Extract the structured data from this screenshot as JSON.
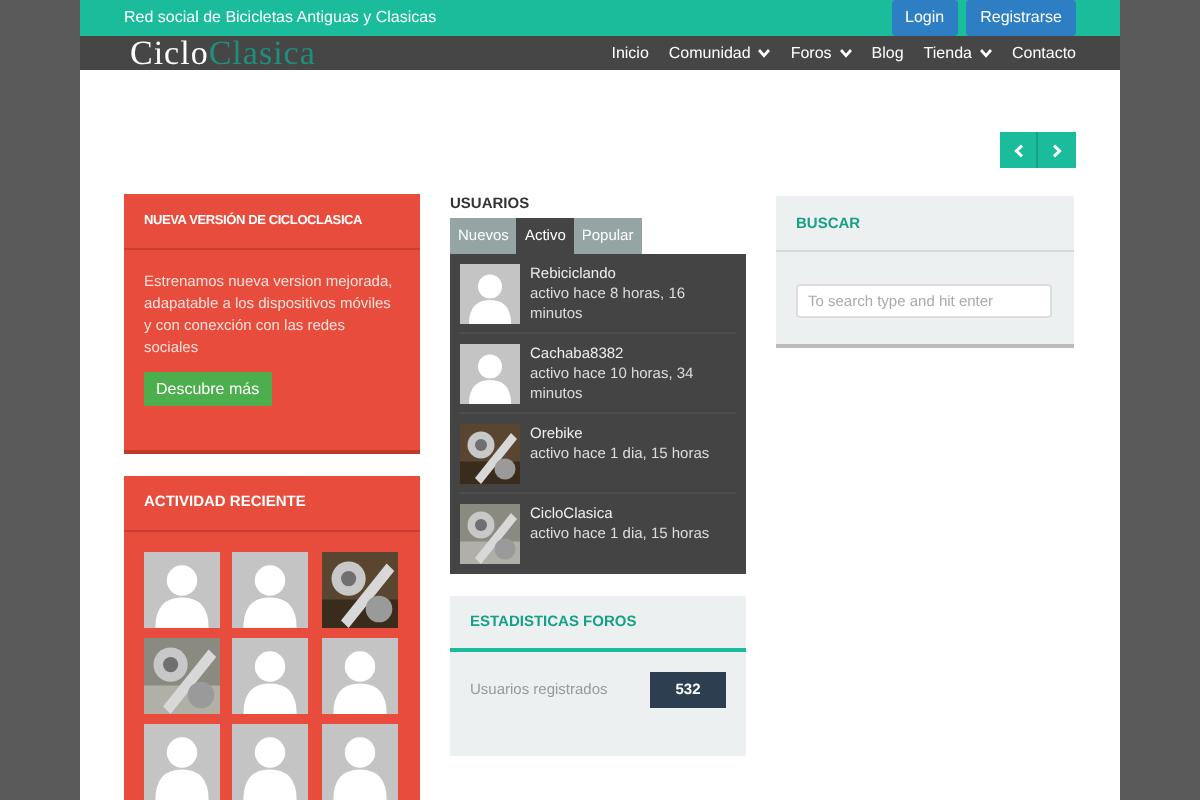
{
  "top_bar": {
    "tagline": "Red social de Bicicletas Antiguas y Clasicas",
    "buttons": [
      "Login",
      "Registrarse"
    ]
  },
  "logo": {
    "part_1": "Ciclo",
    "part_2": "Clasica"
  },
  "nav": [
    {
      "label": "Inicio",
      "dropdown": false
    },
    {
      "label": "Comunidad",
      "dropdown": true
    },
    {
      "label": "Foros",
      "dropdown": true
    },
    {
      "label": "Blog",
      "dropdown": false
    },
    {
      "label": "Tienda",
      "dropdown": true
    },
    {
      "label": "Contacto",
      "dropdown": false
    }
  ],
  "announcement": {
    "title": "NUEVA VERSIÓN DE CICLOCLASICA",
    "text": "Estrenamos nueva version mejorada, adapatable a los dispositivos móviles y con conexción con las redes sociales",
    "button": "Descubre más"
  },
  "recent_activity": {
    "title": "ACTIVIDAD RECIENTE",
    "items": [
      {
        "kind": "avatar"
      },
      {
        "kind": "avatar"
      },
      {
        "kind": "picture"
      },
      {
        "kind": "picture"
      },
      {
        "kind": "avatar"
      },
      {
        "kind": "avatar"
      },
      {
        "kind": "avatar"
      },
      {
        "kind": "avatar"
      },
      {
        "kind": "avatar"
      }
    ]
  },
  "users": {
    "title": "USUARIOS",
    "tabs": [
      {
        "label": "Nuevos",
        "selected": false
      },
      {
        "label": "Activo",
        "selected": true
      },
      {
        "label": "Popular",
        "selected": false
      }
    ],
    "items": [
      {
        "kind": "avatar",
        "name": "Rebiciclando",
        "activity": "activo hace 8 horas, 16 minutos"
      },
      {
        "kind": "avatar",
        "name": "Cachaba8382",
        "activity": "activo hace 10 horas, 34 minutos"
      },
      {
        "kind": "picture",
        "name": "Orebike",
        "activity": "activo hace 1 dia, 15 horas"
      },
      {
        "kind": "picture",
        "name": "CicloClasica",
        "activity": "activo hace 1 dia, 15 horas"
      }
    ]
  },
  "forum_stats": {
    "title": "ESTADISTICAS FOROS",
    "rows": [
      {
        "label": "Usuarios registrados",
        "value": "532"
      }
    ]
  },
  "search": {
    "title": "BUSCAR",
    "placeholder": "To search type and hit enter"
  }
}
